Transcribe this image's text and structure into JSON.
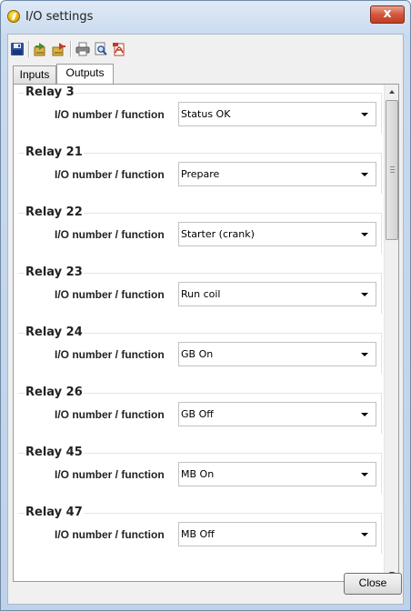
{
  "window": {
    "title": "I/O settings",
    "close_glyph": "x"
  },
  "toolbar": {
    "icons": [
      "save-icon",
      "write-to-controller-icon",
      "read-from-controller-icon",
      "print-icon",
      "print-preview-icon",
      "export-pdf-icon"
    ]
  },
  "tabs": [
    {
      "label": "Inputs",
      "active": false
    },
    {
      "label": "Outputs",
      "active": true
    }
  ],
  "relays": [
    {
      "title": "Relay 3",
      "label": "I/O number / function",
      "value": "Status OK"
    },
    {
      "title": "Relay 21",
      "label": "I/O number / function",
      "value": "Prepare"
    },
    {
      "title": "Relay 22",
      "label": "I/O number / function",
      "value": "Starter (crank)"
    },
    {
      "title": "Relay 23",
      "label": "I/O number / function",
      "value": "Run coil"
    },
    {
      "title": "Relay 24",
      "label": "I/O number / function",
      "value": "GB On"
    },
    {
      "title": "Relay 26",
      "label": "I/O number / function",
      "value": "GB Off"
    },
    {
      "title": "Relay 45",
      "label": "I/O number / function",
      "value": "MB On"
    },
    {
      "title": "Relay 47",
      "label": "I/O number / function",
      "value": "MB Off"
    }
  ],
  "buttons": {
    "close_label": "Close"
  },
  "colors": {
    "title_bar": "#c9daee",
    "close_x": "#d3573d",
    "panel": "#ffffff",
    "client": "#f0f0f0"
  }
}
